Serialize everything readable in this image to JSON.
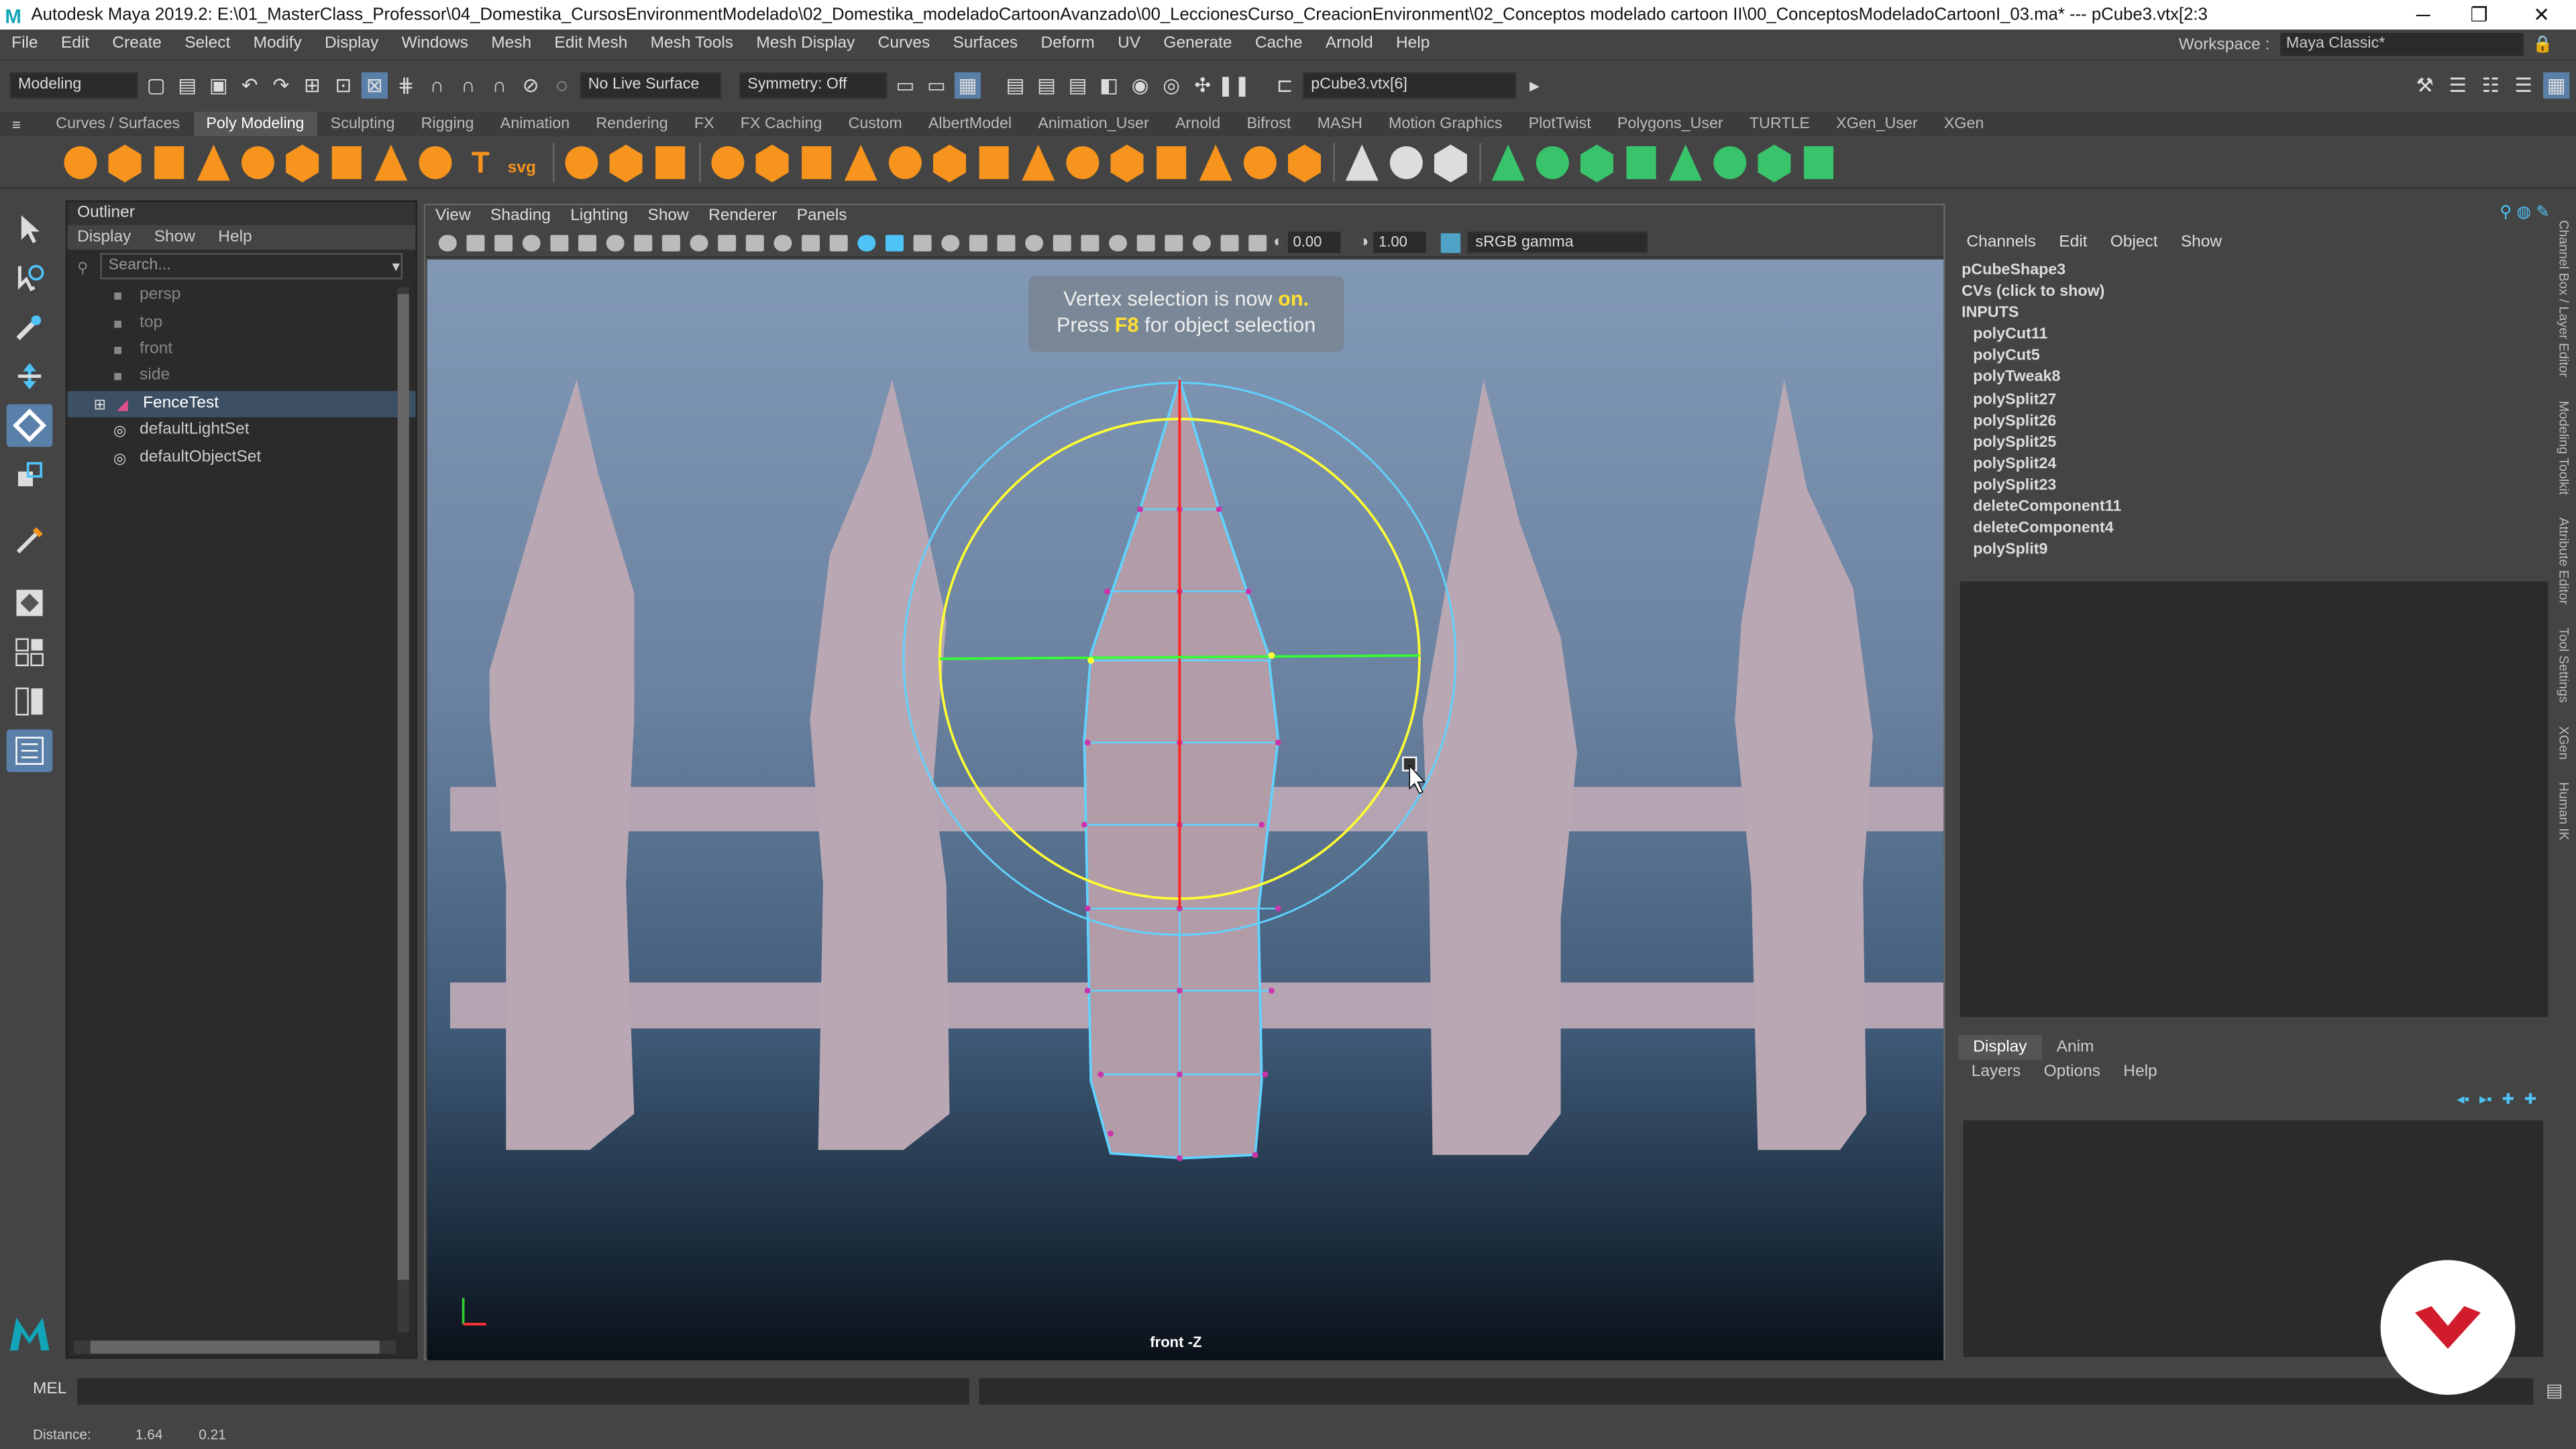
{
  "title": {
    "text": "Autodesk Maya 2019.2: E:\\01_MasterClass_Professor\\04_Domestika_CursosEnvironmentModelado\\02_Domestika_modeladoCartoonAvanzado\\00_LeccionesCurso_CreacionEnvironment\\02_Conceptos modelado cartoon II\\00_ConceptosModeladoCartoonI_03.ma*  ---  pCube3.vtx[2:3",
    "minimize": "─",
    "restore": "❐",
    "close": "✕"
  },
  "menubar": {
    "items": [
      "File",
      "Edit",
      "Create",
      "Select",
      "Modify",
      "Display",
      "Windows",
      "Mesh",
      "Edit Mesh",
      "Mesh Tools",
      "Mesh Display",
      "Curves",
      "Surfaces",
      "Deform",
      "UV",
      "Generate",
      "Cache",
      "Arnold",
      "Help"
    ],
    "workspace_label": "Workspace :",
    "workspace_value": "Maya Classic*"
  },
  "statusline": {
    "mode": "Modeling",
    "live_surface": "No Live Surface",
    "symmetry": "Symmetry: Off",
    "selection_field": "pCube3.vtx[6]"
  },
  "shelf": {
    "tabs": [
      "Curves / Surfaces",
      "Poly Modeling",
      "Sculpting",
      "Rigging",
      "Animation",
      "Rendering",
      "FX",
      "FX Caching",
      "Custom",
      "AlbertModel",
      "Animation_User",
      "Arnold",
      "Bifrost",
      "MASH",
      "Motion Graphics",
      "PlotTwist",
      "Polygons_User",
      "TURTLE",
      "XGen_User",
      "XGen"
    ],
    "active_tab": "Poly Modeling",
    "text_icon": "T",
    "svg_icon": "svg"
  },
  "outliner": {
    "title": "Outliner",
    "menu": [
      "Display",
      "Show",
      "Help"
    ],
    "search_placeholder": "Search...",
    "items": [
      {
        "label": "persp",
        "icon": "camera-icon",
        "dim": true
      },
      {
        "label": "top",
        "icon": "camera-icon",
        "dim": true
      },
      {
        "label": "front",
        "icon": "camera-icon",
        "dim": true
      },
      {
        "label": "side",
        "icon": "camera-icon",
        "dim": true
      },
      {
        "label": "FenceTest",
        "icon": "mesh-icon",
        "selected": true
      },
      {
        "label": "defaultLightSet",
        "icon": "set-icon"
      },
      {
        "label": "defaultObjectSet",
        "icon": "set-icon"
      }
    ]
  },
  "viewport": {
    "menu": [
      "View",
      "Shading",
      "Lighting",
      "Show",
      "Renderer",
      "Panels"
    ],
    "field1": "0.00",
    "field2": "1.00",
    "color_space": "sRGB gamma",
    "hint_line1_a": "Vertex selection is now",
    "hint_line1_b": "on.",
    "hint_line2_a": "Press",
    "hint_line2_b": "F8",
    "hint_line2_c": "for object selection",
    "camera_label": "front -Z"
  },
  "channelbox": {
    "menu": [
      "Channels",
      "Edit",
      "Object",
      "Show"
    ],
    "shape": "pCubeShape3",
    "cvs": "CVs (click to show)",
    "inputs_label": "INPUTS",
    "inputs": [
      "polyCut11",
      "polyCut5",
      "polyTweak8",
      "polySplit27",
      "polySplit26",
      "polySplit25",
      "polySplit24",
      "polySplit23",
      "deleteComponent11",
      "deleteComponent4",
      "polySplit9"
    ]
  },
  "layers": {
    "tabs": [
      "Display",
      "Anim"
    ],
    "active_tab": "Display",
    "menu": [
      "Layers",
      "Options",
      "Help"
    ]
  },
  "side_tabs": [
    "Channel Box / Layer Editor",
    "Modeling Toolkit",
    "Attribute Editor",
    "Tool Settings",
    "XGen",
    "Human IK"
  ],
  "cmdline": {
    "label": "MEL"
  },
  "helpline": {
    "label": "Distance:",
    "value1": "1.64",
    "value2": "0.21"
  },
  "colors": {
    "accent": "#f7941d",
    "selected_row": "#3d4f63",
    "manip_yellow": "#ffff33",
    "manip_cyan": "#5fd3ff",
    "axis_red": "#ff2020",
    "axis_green": "#33ff33",
    "fence": "#b9a8b4"
  }
}
